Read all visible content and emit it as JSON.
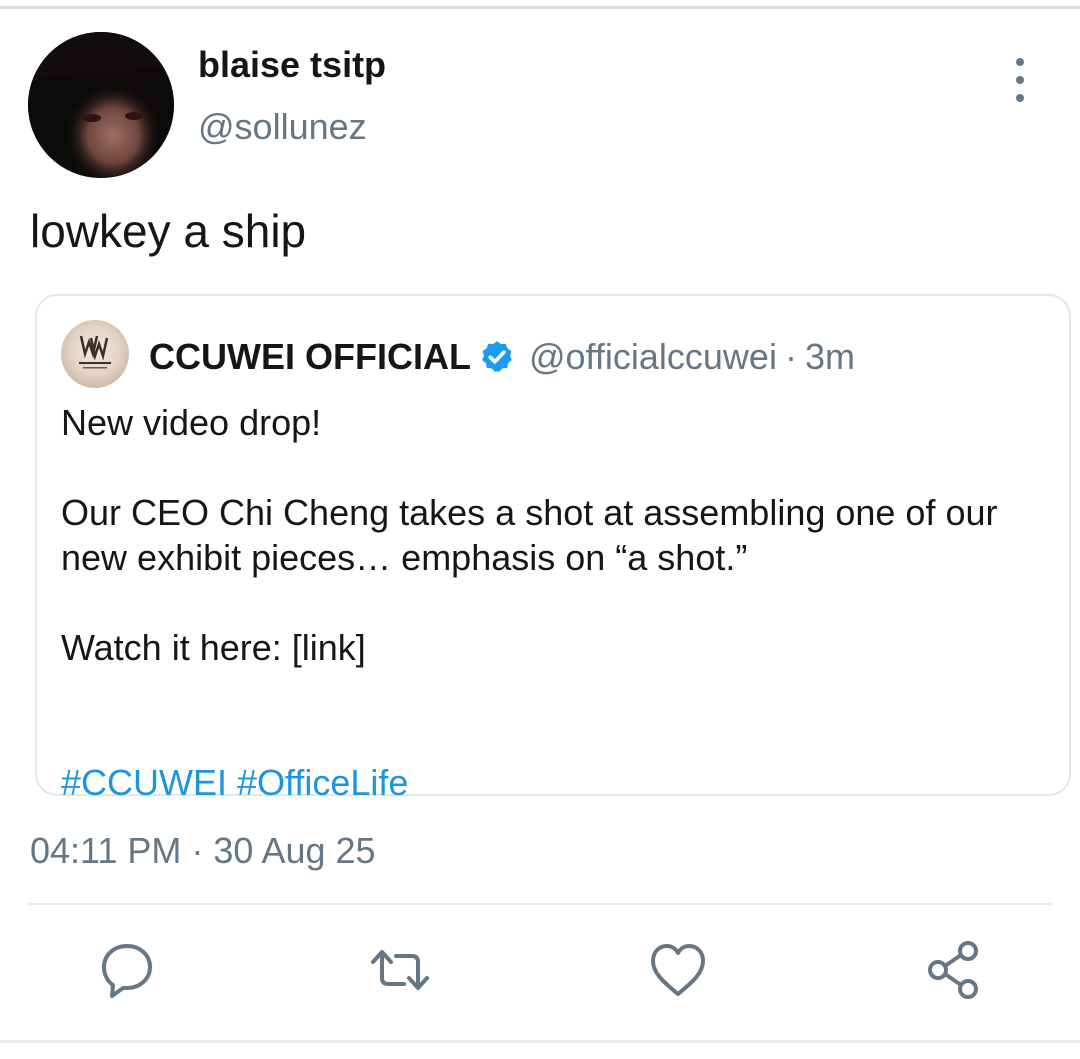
{
  "tweet": {
    "author": {
      "display_name": "blaise tsitp",
      "handle": "@sollunez",
      "avatar_icon": "user-avatar-photo"
    },
    "text": "lowkey a ship",
    "timestamp": "04:11 PM · 30 Aug 25"
  },
  "quoted_tweet": {
    "author": {
      "display_name": "CCUWEI OFFICIAL",
      "verified": true,
      "handle": "@officialccuwei",
      "separator": "·",
      "time_ago": "3m",
      "avatar_icon": "ccuwei-logo"
    },
    "body": {
      "line1": "New video drop!",
      "para2": "Our CEO Chi Cheng takes a shot at assembling one of our new exhibit pieces… emphasis on “a shot.”",
      "line3": "Watch it here: [link]"
    },
    "hashtags": [
      "#CCUWEI",
      "#OfficeLife"
    ]
  },
  "actions": [
    {
      "icon": "reply-icon"
    },
    {
      "icon": "retweet-icon"
    },
    {
      "icon": "like-icon"
    },
    {
      "icon": "share-icon"
    }
  ],
  "colors": {
    "text_primary": "#14171a",
    "text_secondary": "#657786",
    "link": "#1b95e0",
    "verified_badge": "#1d9bf0",
    "border": "#e1e8ed"
  }
}
